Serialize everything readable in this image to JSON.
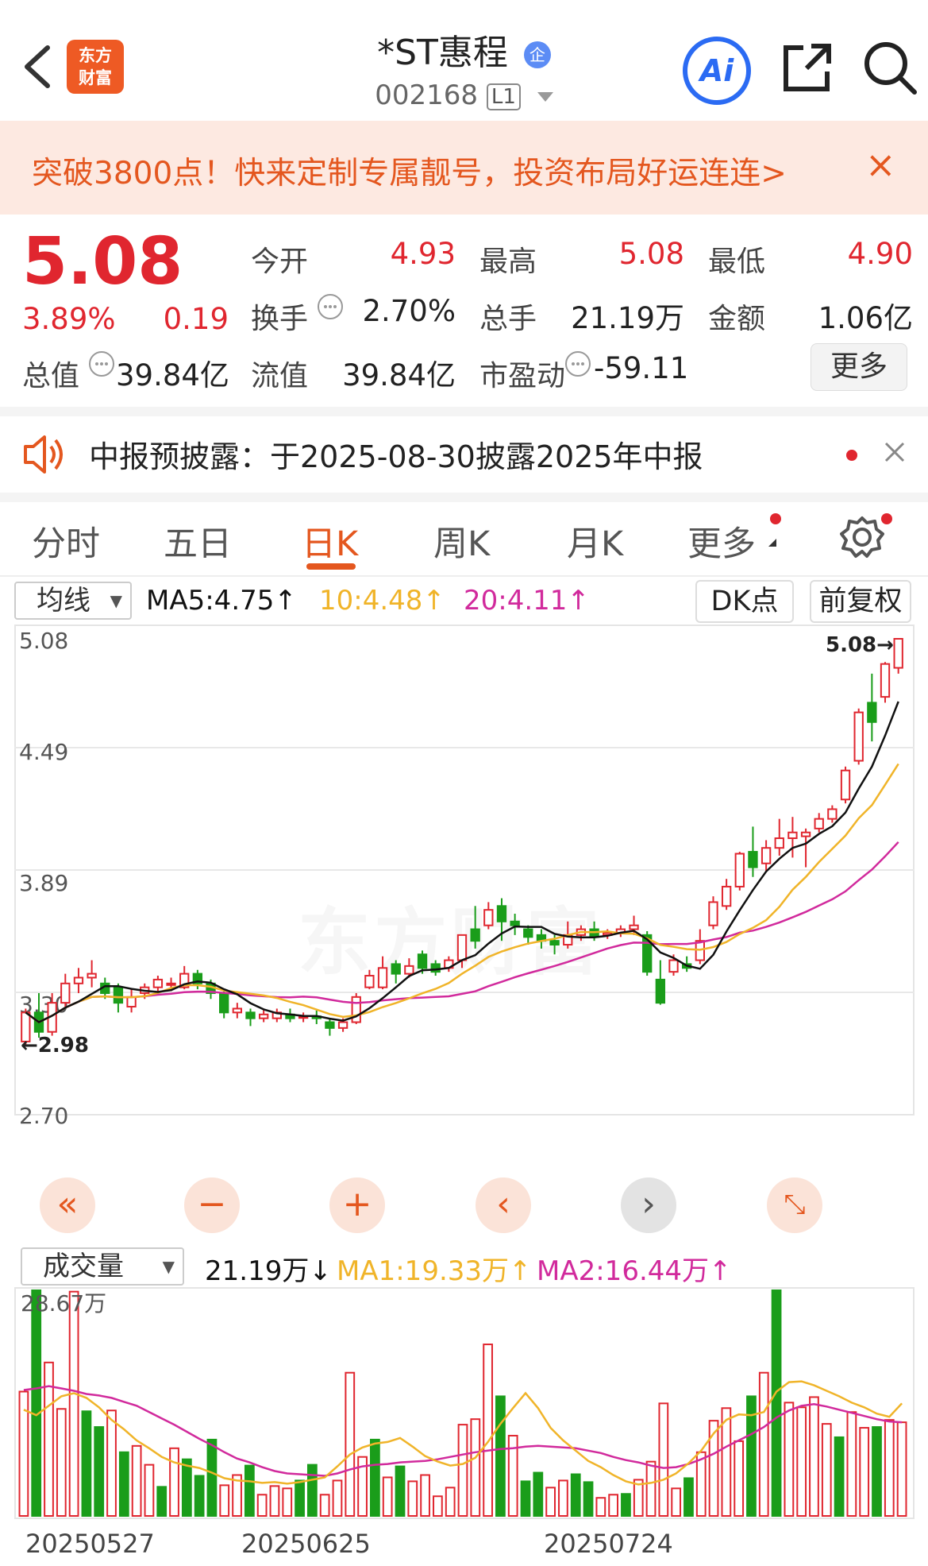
{
  "header": {
    "title": "*ST惠程",
    "badge": "企",
    "code": "002168",
    "level": "L1",
    "logo_line1": "东方",
    "logo_line2": "财富",
    "ai_label": "Ai"
  },
  "banner": {
    "text": "突破3800点！快来定制专属靓号，投资布局好运连连>",
    "close": "×"
  },
  "quote": {
    "price": "5.08",
    "change_pct": "3.89%",
    "change": "0.19",
    "fields": [
      {
        "label": "今开",
        "value": "4.93",
        "color": "red"
      },
      {
        "label": "最高",
        "value": "5.08",
        "color": "red"
      },
      {
        "label": "最低",
        "value": "4.90",
        "color": "red"
      },
      {
        "label": "换手",
        "value": "2.70%",
        "color": "dark"
      },
      {
        "label": "总手",
        "value": "21.19万",
        "color": "dark"
      },
      {
        "label": "金额",
        "value": "1.06亿",
        "color": "dark"
      },
      {
        "label": "总值",
        "value": "39.84亿",
        "color": "dark"
      },
      {
        "label": "流值",
        "value": "39.84亿",
        "color": "dark"
      },
      {
        "label": "市盈动",
        "value": "-59.11",
        "color": "dark"
      }
    ],
    "more_label": "更多"
  },
  "notice": {
    "text": "中报预披露：于2025-08-30披露2025年中报"
  },
  "tabs": [
    "分时",
    "五日",
    "日K",
    "周K",
    "月K",
    "更多"
  ],
  "active_tab": "日K",
  "kline_toolbar": {
    "indicator": "均线",
    "ma5": "MA5:4.75↑",
    "ma10": "10:4.48↑",
    "ma20": "20:4.11↑",
    "dk_label": "DK点",
    "adjust_label": "前复权"
  },
  "volume_toolbar": {
    "indicator": "成交量",
    "vol": "21.19万↓",
    "ma1": "MA1:19.33万↑",
    "ma2": "MA2:16.44万↑"
  },
  "colors": {
    "up": "#e0262f",
    "down": "#1a9d1a",
    "accent": "#e4571f",
    "ma5": "#111111",
    "ma10": "#f0b429",
    "ma20": "#d12a9c"
  },
  "watermark": "东方财富",
  "chart_data": [
    {
      "type": "candlestick",
      "ylim": [
        2.7,
        5.08
      ],
      "y_ticks": [
        "5.08",
        "4.49",
        "3.89",
        "3.30",
        "2.70"
      ],
      "high_marker": "5.08→",
      "low_marker": "←2.98",
      "candles": [
        [
          3.0,
          3.15,
          2.98,
          3.17
        ],
        [
          3.15,
          3.05,
          3.02,
          3.25
        ],
        [
          3.05,
          3.2,
          3.03,
          3.25
        ],
        [
          3.2,
          3.3,
          3.18,
          3.35
        ],
        [
          3.3,
          3.33,
          3.25,
          3.38
        ],
        [
          3.33,
          3.35,
          3.28,
          3.42
        ],
        [
          3.3,
          3.25,
          3.22,
          3.33
        ],
        [
          3.28,
          3.2,
          3.15,
          3.3
        ],
        [
          3.18,
          3.23,
          3.15,
          3.27
        ],
        [
          3.25,
          3.28,
          3.22,
          3.3
        ],
        [
          3.28,
          3.32,
          3.26,
          3.34
        ],
        [
          3.3,
          3.3,
          3.26,
          3.33
        ],
        [
          3.28,
          3.35,
          3.27,
          3.39
        ],
        [
          3.35,
          3.3,
          3.27,
          3.37
        ],
        [
          3.3,
          3.25,
          3.22,
          3.32
        ],
        [
          3.25,
          3.15,
          3.12,
          3.27
        ],
        [
          3.15,
          3.17,
          3.12,
          3.2
        ],
        [
          3.15,
          3.12,
          3.08,
          3.17
        ],
        [
          3.12,
          3.14,
          3.1,
          3.17
        ],
        [
          3.12,
          3.15,
          3.1,
          3.17
        ],
        [
          3.14,
          3.12,
          3.1,
          3.17
        ],
        [
          3.13,
          3.13,
          3.1,
          3.15
        ],
        [
          3.13,
          3.12,
          3.09,
          3.16
        ],
        [
          3.1,
          3.07,
          3.03,
          3.12
        ],
        [
          3.07,
          3.1,
          3.05,
          3.12
        ],
        [
          3.1,
          3.23,
          3.09,
          3.25
        ],
        [
          3.28,
          3.34,
          3.27,
          3.37
        ],
        [
          3.28,
          3.38,
          3.27,
          3.44
        ],
        [
          3.4,
          3.35,
          3.3,
          3.42
        ],
        [
          3.35,
          3.39,
          3.33,
          3.43
        ],
        [
          3.45,
          3.38,
          3.35,
          3.47
        ],
        [
          3.4,
          3.36,
          3.34,
          3.42
        ],
        [
          3.38,
          3.42,
          3.36,
          3.44
        ],
        [
          3.42,
          3.55,
          3.38,
          3.55
        ],
        [
          3.58,
          3.52,
          3.48,
          3.7
        ],
        [
          3.6,
          3.68,
          3.58,
          3.72
        ],
        [
          3.7,
          3.62,
          3.52,
          3.74
        ],
        [
          3.62,
          3.6,
          3.55,
          3.66
        ],
        [
          3.58,
          3.54,
          3.5,
          3.6
        ],
        [
          3.55,
          3.52,
          3.48,
          3.58
        ],
        [
          3.52,
          3.5,
          3.45,
          3.55
        ],
        [
          3.5,
          3.55,
          3.48,
          3.62
        ],
        [
          3.55,
          3.58,
          3.52,
          3.6
        ],
        [
          3.58,
          3.54,
          3.52,
          3.62
        ],
        [
          3.55,
          3.56,
          3.53,
          3.58
        ],
        [
          3.56,
          3.58,
          3.54,
          3.6
        ],
        [
          3.58,
          3.6,
          3.55,
          3.65
        ],
        [
          3.55,
          3.36,
          3.34,
          3.57
        ],
        [
          3.32,
          3.2,
          3.19,
          3.42
        ],
        [
          3.36,
          3.42,
          3.34,
          3.45
        ],
        [
          3.4,
          3.38,
          3.36,
          3.44
        ],
        [
          3.42,
          3.52,
          3.4,
          3.58
        ],
        [
          3.6,
          3.72,
          3.58,
          3.75
        ],
        [
          3.7,
          3.8,
          3.68,
          3.84
        ],
        [
          3.8,
          3.97,
          3.78,
          3.98
        ],
        [
          3.98,
          3.9,
          3.85,
          4.11
        ],
        [
          3.92,
          4.0,
          3.88,
          4.04
        ],
        [
          4.0,
          4.05,
          3.96,
          4.15
        ],
        [
          4.05,
          4.08,
          3.95,
          4.16
        ],
        [
          4.06,
          4.08,
          3.9,
          4.1
        ],
        [
          4.1,
          4.15,
          4.08,
          4.18
        ],
        [
          4.15,
          4.2,
          4.13,
          4.22
        ],
        [
          4.25,
          4.4,
          4.23,
          4.42
        ],
        [
          4.45,
          4.7,
          4.43,
          4.72
        ],
        [
          4.75,
          4.65,
          4.55,
          4.9
        ],
        [
          4.78,
          4.95,
          4.75,
          4.96
        ],
        [
          4.93,
          5.08,
          4.9,
          5.08
        ]
      ]
    },
    {
      "type": "bar",
      "title": "成交量",
      "max_label": "28.67万",
      "x_labels": [
        "20250527",
        "20250625",
        "20250724"
      ],
      "values": [
        15.8,
        28.67,
        19.5,
        13.6,
        28.5,
        13.3,
        11.3,
        13.4,
        8.1,
        8.9,
        6.5,
        3.7,
        8.6,
        7.2,
        5.1,
        9.7,
        3.9,
        5.2,
        6.4,
        2.7,
        3.8,
        3.5,
        4.5,
        6.5,
        2.7,
        4.5,
        18.2,
        7.5,
        9.7,
        4.9,
        6.3,
        4.4,
        5.2,
        2.5,
        3.6,
        11.6,
        12.3,
        21.8,
        15.2,
        10.2,
        4.4,
        5.5,
        3.6,
        4.5,
        5.3,
        4.3,
        2.3,
        2.7,
        2.8,
        4.6,
        6.9,
        14.3,
        3.5,
        4.8,
        8.1,
        12.1,
        13.7,
        9.5,
        15.2,
        18.2,
        28.67,
        14.4,
        13.8,
        15.1,
        11.7,
        10.0,
        13.2,
        11.2,
        11.3,
        12.2,
        11.9
      ],
      "up": [
        true,
        false,
        true,
        true,
        true,
        false,
        false,
        true,
        false,
        true,
        true,
        false,
        true,
        false,
        false,
        false,
        true,
        true,
        false,
        true,
        true,
        true,
        false,
        false,
        true,
        true,
        true,
        true,
        false,
        true,
        false,
        true,
        true,
        true,
        true,
        true,
        true,
        true,
        false,
        true,
        false,
        false,
        true,
        true,
        false,
        false,
        true,
        true,
        false,
        true,
        true,
        true,
        true,
        false,
        true,
        true,
        true,
        true,
        false,
        true,
        false,
        true,
        true,
        true,
        true,
        false,
        true,
        true,
        false,
        true,
        true
      ],
      "ma1": [
        13.5,
        12.8,
        14.0,
        15.2,
        15.6,
        15.0,
        13.8,
        12.2,
        11.0,
        9.6,
        8.6,
        7.5,
        6.8,
        6.4,
        6.1,
        5.5,
        4.8,
        4.5,
        4.4,
        4.2,
        4.3,
        4.1,
        4.3,
        4.6,
        4.9,
        6.3,
        7.8,
        8.7,
        9.2,
        9.4,
        9.9,
        8.8,
        7.6,
        6.9,
        6.4,
        6.6,
        7.4,
        9.4,
        11.7,
        13.7,
        15.6,
        13.7,
        11.2,
        9.6,
        8.3,
        7.0,
        6.2,
        5.2,
        4.4,
        4.0,
        4.2,
        4.6,
        5.4,
        6.7,
        8.3,
        10.5,
        12.2,
        12.9,
        12.8,
        13.2,
        15.8,
        17.0,
        17.1,
        16.6,
        15.9,
        15.2,
        14.4,
        13.8,
        13.0,
        12.6,
        14.3
      ],
      "ma2": [
        16.0,
        16.2,
        16.5,
        16.2,
        15.9,
        15.5,
        15.3,
        15.0,
        14.5,
        14.0,
        13.2,
        12.4,
        11.6,
        10.7,
        9.8,
        9.0,
        8.1,
        7.3,
        6.8,
        6.2,
        5.7,
        5.4,
        5.3,
        5.2,
        5.1,
        5.4,
        5.9,
        6.3,
        6.5,
        6.6,
        6.8,
        6.9,
        7.0,
        7.2,
        7.5,
        7.8,
        8.1,
        8.3,
        8.5,
        8.6,
        8.8,
        8.9,
        8.8,
        8.7,
        8.6,
        8.3,
        8.0,
        7.5,
        7.1,
        6.8,
        6.4,
        6.1,
        6.2,
        6.6,
        7.2,
        7.9,
        8.8,
        9.6,
        10.4,
        11.3,
        12.5,
        13.4,
        14.0,
        14.2,
        13.9,
        13.5,
        13.1,
        12.7,
        12.3,
        12.0,
        11.9
      ]
    }
  ]
}
